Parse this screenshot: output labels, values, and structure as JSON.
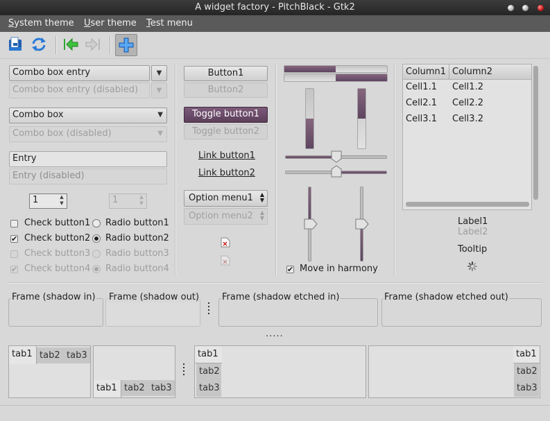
{
  "window": {
    "title": "A widget factory - PitchBlack - Gtk2"
  },
  "menubar": {
    "items": [
      {
        "mnemonic": "S",
        "rest": "ystem theme"
      },
      {
        "mnemonic": "U",
        "rest": "ser theme"
      },
      {
        "mnemonic": "T",
        "rest": "est menu"
      }
    ]
  },
  "toolbar": {
    "icons": [
      "archive-icon",
      "refresh-icon",
      "go-back-icon",
      "go-forward-icon",
      "add-icon"
    ]
  },
  "combos": {
    "entry": "Combo box entry",
    "entry_disabled": "Combo box entry (disabled)",
    "box": "Combo box",
    "box_disabled": "Combo box (disabled)"
  },
  "entries": {
    "entry": "Entry",
    "entry_disabled": "Entry (disabled)"
  },
  "spins": {
    "value": "1",
    "value_disabled": "1"
  },
  "checks": {
    "check1": "Check button1",
    "check2": "Check button2",
    "check3": "Check button3",
    "check4": "Check button4",
    "radio1": "Radio button1",
    "radio2": "Radio button2",
    "radio3": "Radio button3",
    "radio4": "Radio button4"
  },
  "buttons": {
    "button1": "Button1",
    "button2": "Button2",
    "toggle1": "Toggle button1",
    "toggle2": "Toggle button2",
    "link1": "Link button1",
    "link2": "Link button2",
    "option1": "Option menu1",
    "option2": "Option menu2"
  },
  "progress": {
    "top_horizontal": 0.5,
    "bottom_horizontal": 0.5,
    "left_vertical": 0.5,
    "right_vertical": 0.5
  },
  "sliders": {
    "upper_horizontal": 0.5,
    "lower_horizontal": 0.5,
    "left_vertical": 0.5,
    "right_vertical": 0.5
  },
  "harmony": {
    "label": "Move in harmony",
    "checked": true
  },
  "tree": {
    "columns": [
      "Column1",
      "Column2"
    ],
    "rows": [
      [
        "Cell1.1",
        "Cell1.2"
      ],
      [
        "Cell2.1",
        "Cell2.2"
      ],
      [
        "Cell3.1",
        "Cell3.2"
      ]
    ]
  },
  "labels": {
    "label1": "Label1",
    "label2": "Label2",
    "tooltip": "Tooltip"
  },
  "frames": [
    "Frame (shadow in)",
    "Frame (shadow out)",
    "Frame (shadow etched in)",
    "Frame (shadow etched out)"
  ],
  "tabs": [
    "tab1",
    "tab2",
    "tab3"
  ],
  "colors": {
    "accent": "#6a4e68",
    "titlebar": "#2c2c2c",
    "menubar": "#5a5a5a",
    "window": "#d8d8d8"
  }
}
